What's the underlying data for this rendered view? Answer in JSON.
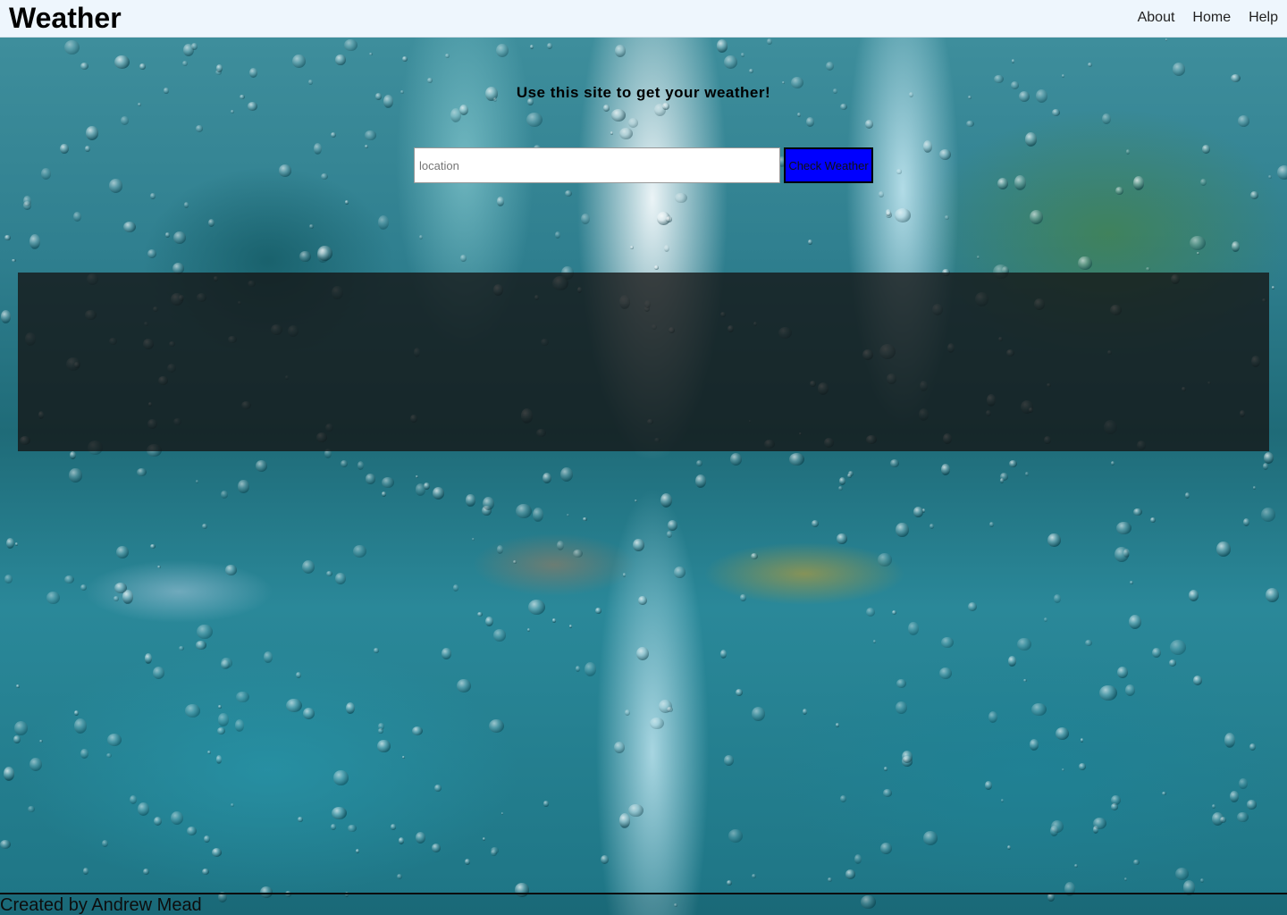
{
  "header": {
    "title": "Weather",
    "nav": [
      {
        "label": "About"
      },
      {
        "label": "Home"
      },
      {
        "label": "Help"
      }
    ]
  },
  "main": {
    "tagline": "Use this site to get your weather!",
    "search": {
      "placeholder": "location",
      "value": "",
      "button_label": "Check Weather"
    },
    "results": {
      "message": ""
    }
  },
  "footer": {
    "credit": "Created by Andrew Mead"
  },
  "colors": {
    "header_bg": "#eef6fd",
    "button_bg": "#0000ff",
    "panel_bg": "rgba(20,20,20,0.78)"
  },
  "background": {
    "image": "rainy-window-street-background"
  }
}
